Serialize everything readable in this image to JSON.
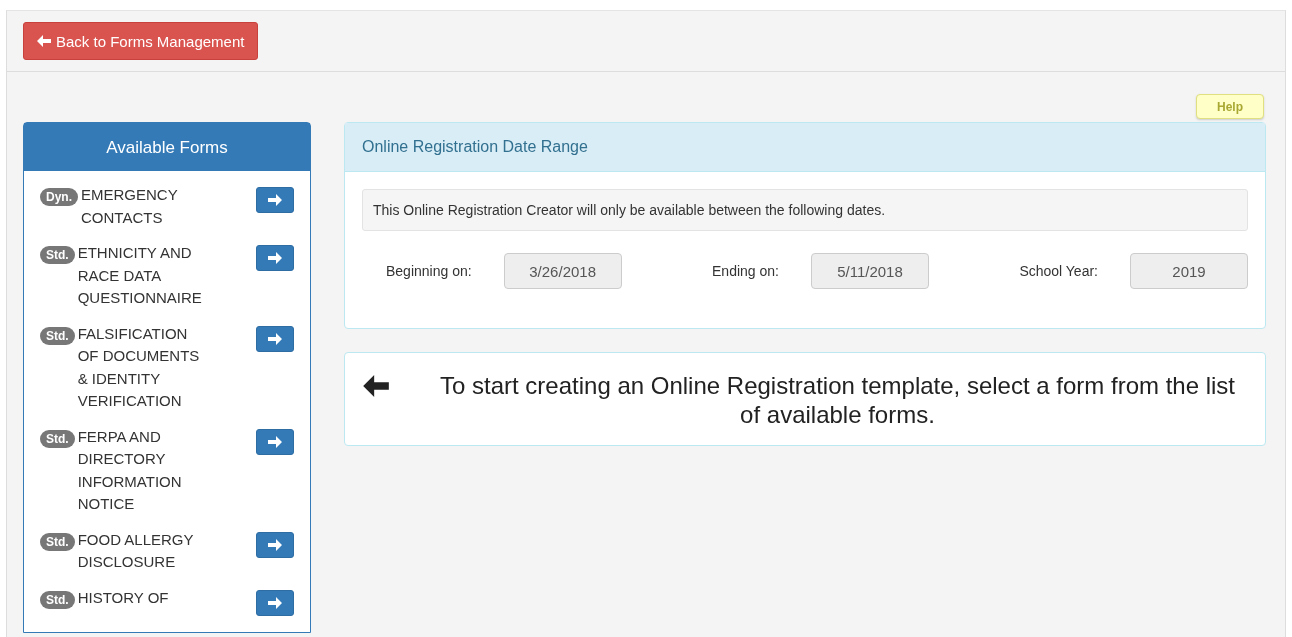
{
  "back_button": {
    "label": "Back to Forms Management"
  },
  "help_button": {
    "label": "Help"
  },
  "sidebar": {
    "title": "Available Forms",
    "items": [
      {
        "badge": "Dyn.",
        "lines": [
          "EMERGENCY",
          "CONTACTS"
        ]
      },
      {
        "badge": "Std.",
        "lines": [
          "ETHNICITY AND",
          "RACE DATA",
          "QUESTIONNAIRE"
        ]
      },
      {
        "badge": "Std.",
        "lines": [
          "FALSIFICATION",
          "OF DOCUMENTS",
          "& IDENTITY",
          "VERIFICATION"
        ]
      },
      {
        "badge": "Std.",
        "lines": [
          "FERPA AND",
          "DIRECTORY",
          "INFORMATION",
          "NOTICE"
        ]
      },
      {
        "badge": "Std.",
        "lines": [
          "FOOD ALLERGY",
          "DISCLOSURE"
        ]
      },
      {
        "badge": "Std.",
        "lines": [
          "HISTORY OF"
        ]
      }
    ]
  },
  "date_panel": {
    "title": "Online Registration Date Range",
    "note": "This Online Registration Creator will only be available between the following dates.",
    "fields": [
      {
        "label": "Beginning on:",
        "value": "3/26/2018"
      },
      {
        "label": "Ending on:",
        "value": "5/11/2018"
      },
      {
        "label": "School Year:",
        "value": "2019"
      }
    ]
  },
  "instruction": "To start creating an Online Registration template, select a form from the list of available forms."
}
